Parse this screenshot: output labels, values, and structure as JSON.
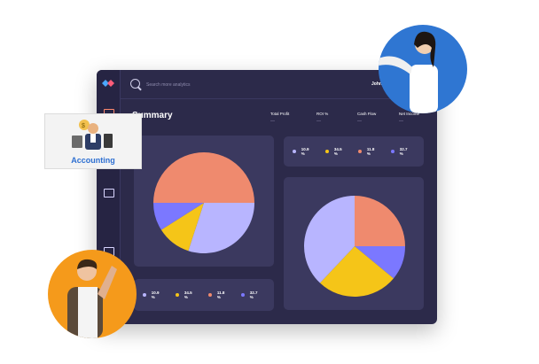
{
  "search": {
    "placeholder": "Search more analytics"
  },
  "user": {
    "name": "John"
  },
  "page": {
    "title": "Summary"
  },
  "stats": [
    {
      "label": "Total Profit",
      "value": "—"
    },
    {
      "label": "ROI %",
      "value": "—"
    },
    {
      "label": "Cash Flow",
      "value": "—"
    },
    {
      "label": "Net Income",
      "value": "—"
    }
  ],
  "legend_top": [
    {
      "label": "10.9 %",
      "color": "#b8b5ff"
    },
    {
      "label": "34.5 %",
      "color": "#f5c518"
    },
    {
      "label": "11.8 %",
      "color": "#ef8a6e"
    },
    {
      "label": "32.7 %",
      "color": "#7b78ff"
    }
  ],
  "legend_bottom": [
    {
      "label": "10.9 %",
      "color": "#b8b5ff"
    },
    {
      "label": "34.5 %",
      "color": "#f5c518"
    },
    {
      "label": "11.8 %",
      "color": "#ef8a6e"
    },
    {
      "label": "32.7 %",
      "color": "#7b78ff"
    }
  ],
  "accounting": {
    "label": "Accounting"
  },
  "chart_data": [
    {
      "type": "pie",
      "title": "",
      "categories": [
        "salmon",
        "lavender",
        "yellow",
        "purple"
      ],
      "values": [
        50,
        30,
        11,
        9
      ],
      "colors": [
        "#ef8a6e",
        "#b8b5ff",
        "#f5c518",
        "#7b78ff"
      ]
    },
    {
      "type": "pie",
      "title": "",
      "categories": [
        "salmon",
        "purple",
        "yellow",
        "lavender"
      ],
      "values": [
        25,
        11,
        26,
        38
      ],
      "colors": [
        "#ef8a6e",
        "#7b78ff",
        "#f5c518",
        "#b8b5ff"
      ]
    }
  ]
}
